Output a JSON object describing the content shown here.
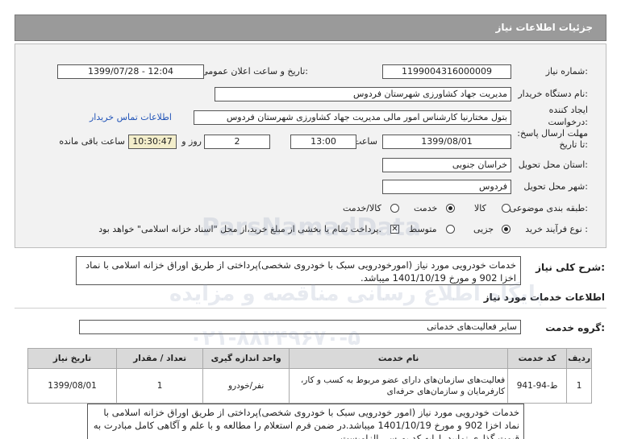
{
  "header": {
    "title": "جزئیات اطلاعات نیاز"
  },
  "form": {
    "need_number_label": "شماره نیاز:",
    "need_number": "1199004316000009",
    "announce_label": "تاریخ و ساعت اعلان عمومی:",
    "announce_value": "1399/07/28 - 12:04",
    "buyer_label": "نام دستگاه خریدار:",
    "buyer_value": "مدیریت جهاد کشاورزی شهرستان فردوس",
    "requester_label": "ایجاد کننده درخواست:",
    "requester_value": "بتول  مختارنیا کارشناس امور مالی مدیریت جهاد کشاورزی شهرستان فردوس",
    "contact_link": "اطلاعات تماس خریدار",
    "deadline_label": "مهلت ارسال پاسخ: تا تاریخ:",
    "deadline_date": "1399/08/01",
    "time_label": "ساعت",
    "deadline_time": "13:00",
    "days_value": "2",
    "days_label": "روز و",
    "remaining_time": "10:30:47",
    "remaining_label": "ساعت باقی مانده",
    "province_label": "استان محل تحویل:",
    "province_value": "خراسان جنوبی",
    "city_label": "شهر محل تحویل:",
    "city_value": "فردوس",
    "category_label": "طبقه بندی موضوعی:",
    "category_options": [
      "کالا",
      "خدمت",
      "کالا/خدمت"
    ],
    "category_selected": "خدمت",
    "process_label": "نوع فرآیند خرید :",
    "process_options": [
      "جزیی",
      "متوسط"
    ],
    "process_selected": "جزیی",
    "payment_note": "پرداخت تمام یا بخشی از مبلغ خرید،از محل \"اسناد خزانه اسلامی\" خواهد بود."
  },
  "summary": {
    "label": "شرح کلی نیاز:",
    "text": "خدمات خودرویی مورد نیاز (امورخودرویی سبک با خودروی شخصی)پرداختی از طریق اوراق خزانه اسلامی با نماد اخزا 902 و مورخ 1401/10/19 میباشد."
  },
  "services": {
    "section_title": "اطلاعات خدمات مورد نیاز",
    "group_label": "گروه خدمت:",
    "group_value": "سایر فعالیت‌های خدماتی",
    "columns": [
      "ردیف",
      "کد خدمت",
      "نام خدمت",
      "واحد اندازه گیری",
      "تعداد / مقدار",
      "تاریخ نیاز"
    ],
    "rows": [
      [
        "1",
        "ط-94-941",
        "فعالیت‌های سازمان‌های دارای عضو مربوط به کسب و کار، کارفرمایان و سازمان‌های حرفه‌ای",
        "نفر/خودرو",
        "1",
        "1399/08/01"
      ]
    ]
  },
  "buyer_notes": {
    "text": "خدمات خودرویی مورد نیاز (امور خودرویی سبک با خودروی شخصی)پرداختی از طریق اوراق خزانه اسلامی با نماد اخزا 902 و مورخ 1401/10/19 میباشد.در ضمن فرم استعلام را مطالعه و با علم و آگاهی کامل مبادرت به قیمت گذاری نمایید. ارایه کد بورسی الزامیست."
  },
  "watermark": {
    "en": "ParsNamadData",
    "fa1": "پایگاه اطلاع رسانی مناقصه و مزایده",
    "fa2": "۰۲۱-۸۸۳۴۹۶۷۰-۵"
  }
}
